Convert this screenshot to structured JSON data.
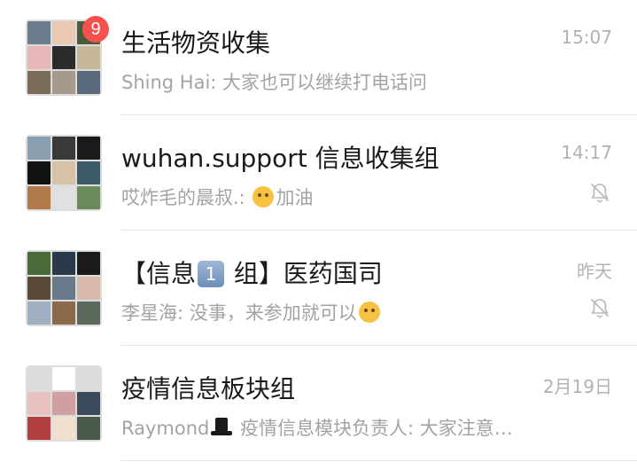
{
  "chats": [
    {
      "title": "生活物资收集",
      "preview": "Shing Hai: 大家也可以继续打电话问",
      "time": "15:07",
      "unread": "9",
      "muted": false,
      "avatar_colors": [
        "#6b7d8c",
        "#e9c9b2",
        "#4a5a3a",
        "#e8b8b8",
        "#2b2b2b",
        "#c8b89a",
        "#7a6a5a",
        "#a89a8a",
        "#5a6a7a"
      ]
    },
    {
      "title": "wuhan.support 信息收集组",
      "preview_sender": "哎炸毛的晨叔.: ",
      "preview_text": "加油",
      "time": "14:17",
      "muted": true,
      "avatar_colors": [
        "#8aa0b0",
        "#3a3a3a",
        "#1a1a1a",
        "#111111",
        "#d6c2a8",
        "#3d5a6a",
        "#b07a4a",
        "#e0e0e0",
        "#6a8a5a"
      ]
    },
    {
      "title_prefix": "【信息",
      "title_keycap": "1",
      "title_suffix": " 组】医药国司",
      "preview_text": "李星海: 没事，来参加就可以",
      "time": "昨天",
      "muted": true,
      "avatar_colors": [
        "#4a6a3a",
        "#2a3a4a",
        "#1a1a1a",
        "#5a4a3a",
        "#6a7a8a",
        "#d8b8a8",
        "#a0b0c0",
        "#8a6a4a",
        "#5a6a5a"
      ]
    },
    {
      "title": "疫情信息板块组",
      "preview_sender": "Raymond",
      "preview_text": " 疫情信息模块负责人: 大家注意…",
      "time": "2月19日",
      "muted": false,
      "avatar_colors": [
        "#dcdcdc",
        "#ffffff",
        "#dcdcdc",
        "#e8c0c0",
        "#d0a0a0",
        "#3a4a5a",
        "#b04040",
        "#f0e0d0",
        "#4a5a4a"
      ]
    }
  ],
  "icons": {
    "mute": "bell-off-icon",
    "emoji_1": "shushing-face-emoji",
    "emoji_2": "relieved-face-emoji",
    "keycap": "keycap-1-emoji",
    "hat": "top-hat-emoji"
  },
  "colors": {
    "badge": "#f5524e",
    "title": "#1a1a1a",
    "preview": "#a3a3a3",
    "time": "#b2b2b2"
  }
}
